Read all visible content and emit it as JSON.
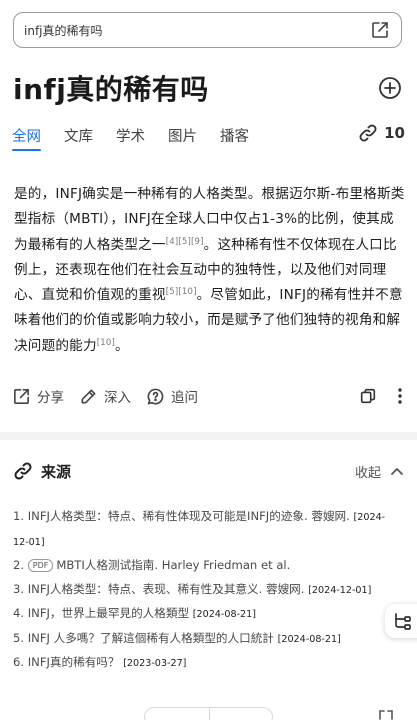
{
  "search": {
    "query": "infj真的稀有吗"
  },
  "header": {
    "title": "infj真的稀有吗"
  },
  "tabs": [
    {
      "label": "全网",
      "active": true
    },
    {
      "label": "文库"
    },
    {
      "label": "学术"
    },
    {
      "label": "图片"
    },
    {
      "label": "播客"
    }
  ],
  "source_count": "10",
  "answer": {
    "p1": "是的，INFJ确实是一种稀有的人格类型。根据迈尔斯-布里格斯类型指标（MBTI），INFJ在全球人口中仅占1-3%的比例，使其成为最稀有的人格类型之一",
    "c1": "[4][5][9]",
    "p2": "。这种稀有性不仅体现在人口比例上，还表现在他们在社会互动中的独特性，以及他们对同理心、直觉和价值观的重视",
    "c2": "[5][10]",
    "p3": "。尽管如此，INFJ的稀有性并不意味着他们的价值或影响力较小，而是赋予了他们独特的视角和解决问题的能力",
    "c3": "[10]",
    "p4": "。"
  },
  "actions": {
    "share": "分享",
    "deep": "深入",
    "ask": "追问"
  },
  "sources_section": {
    "label": "来源",
    "collapse": "收起"
  },
  "sources": [
    {
      "text": "1. INFJ人格类型：特点、稀有性体现及可能是INFJ的迹象. 蓉嫂网.",
      "date": "[2024-12-01]"
    },
    {
      "pdf": "PDF",
      "text": "MBTI人格测试指南. Harley Friedman et al.",
      "prefix": "2."
    },
    {
      "text": "3. INFJ人格类型：特点、表现、稀有性及其意义. 蓉嫂网.",
      "date": "[2024-12-01]"
    },
    {
      "text": "4. INFJ，世界上最罕見的人格類型",
      "date": "[2024-08-21]"
    },
    {
      "text": "5. INFJ 人多嗎？了解這個稀有人格類型的人口統計",
      "date": "[2024-08-21]"
    },
    {
      "text": "6. INFJ真的稀有吗？",
      "date": "[2023-03-27]"
    }
  ],
  "colors": {
    "accent": "#1a73e8",
    "divider": "#f2f3f5"
  }
}
